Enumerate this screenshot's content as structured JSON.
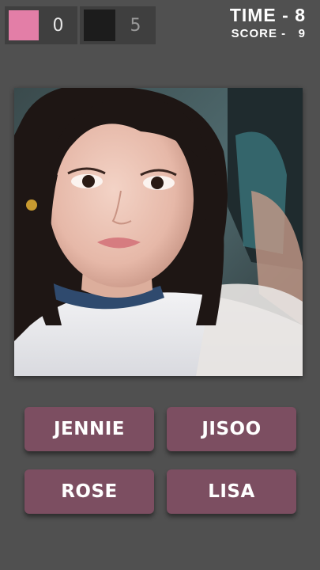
{
  "counters": {
    "pink": {
      "color": "#e37ea7",
      "value": "0"
    },
    "black": {
      "color": "#1c1c1c",
      "value": "5"
    }
  },
  "hud": {
    "time_label": "TIME -",
    "time_value": "8",
    "score_label": "SCORE -",
    "score_value": "9"
  },
  "answers": [
    "JENNIE",
    "JISOO",
    "ROSE",
    "LISA"
  ],
  "colors": {
    "background": "#505050",
    "button": "#7c4e61",
    "button_text": "#ffffff"
  }
}
